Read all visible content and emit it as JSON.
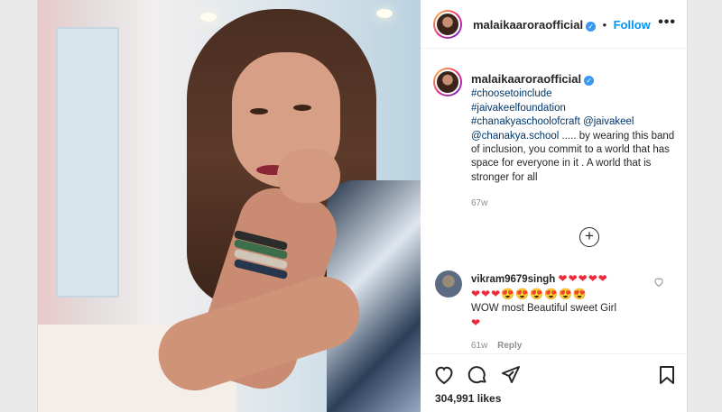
{
  "post": {
    "username": "malaikaaroraofficial",
    "verified_mark": "✓",
    "dot": "•",
    "follow_label": "Follow",
    "more_label": "•••"
  },
  "caption": {
    "username": "malaikaaroraofficial",
    "hashtags": [
      "#choosetoinclude",
      "#jaivakeelfoundation"
    ],
    "line3_tag": "#chanakyaschoolofcraft",
    "line3_mention": "@jaivakeel",
    "line4_mention": "@chanakya.school",
    "line4_rest": " ..... by wearing this band of inclusion, you commit to a world that has space for everyone in it . A world that is stronger for all",
    "time": "67w"
  },
  "load_more_label": "+",
  "comment": {
    "username": "vikram9679singh",
    "hearts_row": "❤❤❤❤❤",
    "hearts_row2": "❤❤❤",
    "emoji_row": "😍😍😍😍😍😍",
    "text": "WOW most Beautiful sweet Girl",
    "trailing_heart": "❤",
    "time": "61w",
    "reply_label": "Reply",
    "like_icon": "heart-outline-icon"
  },
  "actions": {
    "icons": [
      "heart-icon",
      "comment-icon",
      "share-icon",
      "bookmark-icon"
    ],
    "likes": "304,991 likes"
  },
  "colors": {
    "link": "#00376b",
    "follow": "#0095f6",
    "heart": "#ed2a3a",
    "muted": "#8e8e8e"
  }
}
